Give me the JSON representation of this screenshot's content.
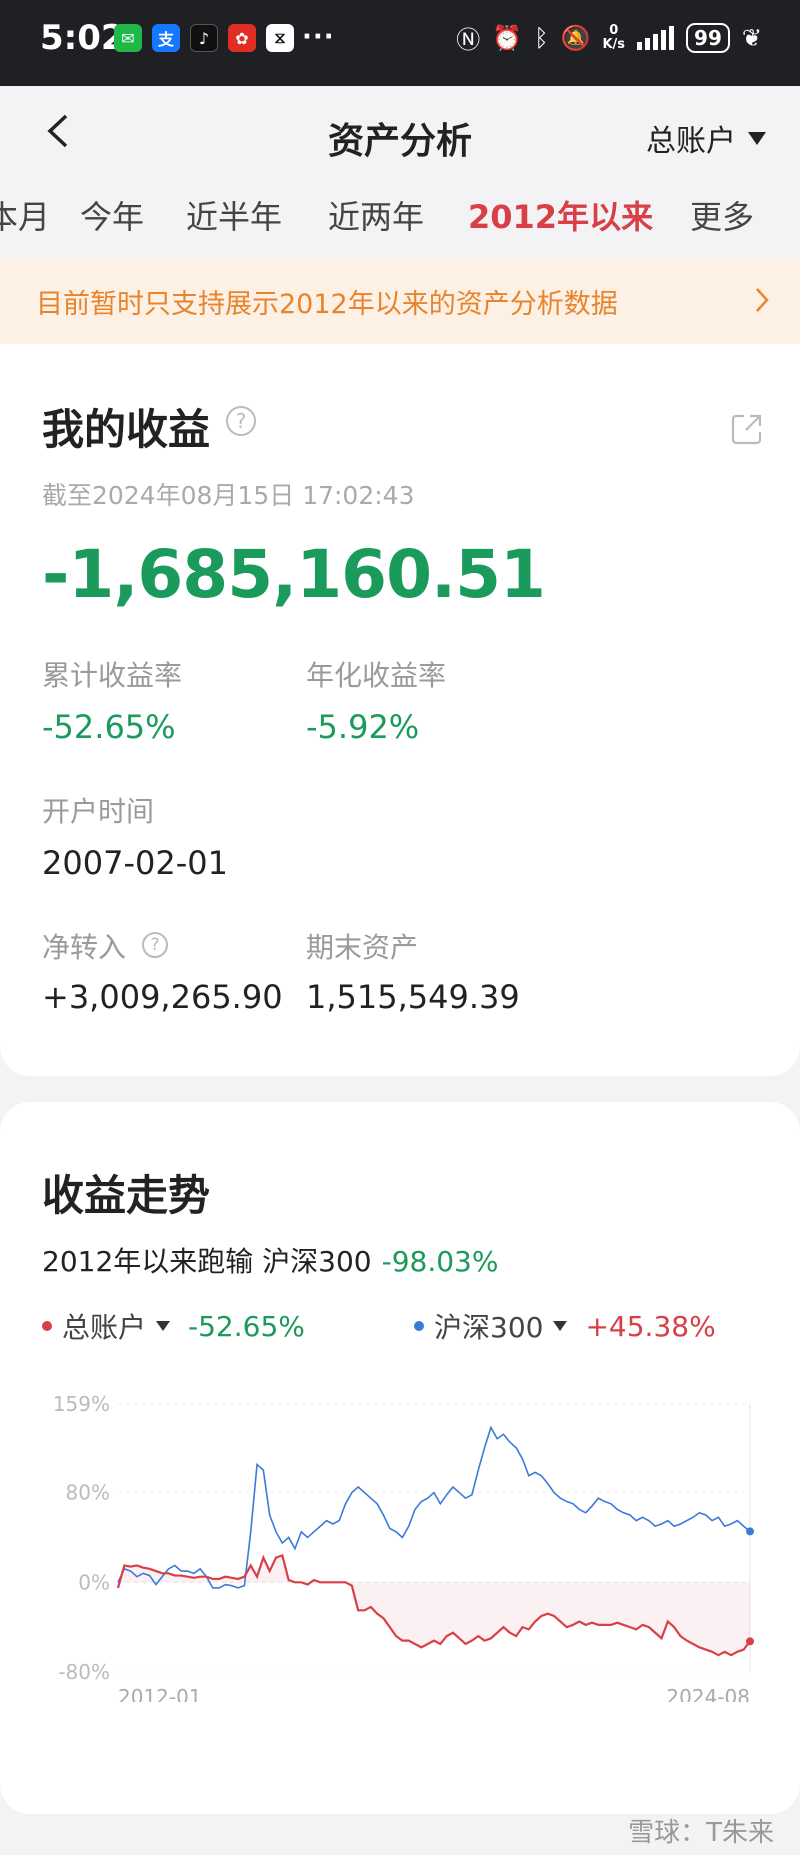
{
  "status": {
    "time": "5:02",
    "dots": "···",
    "net_speed_top": "0",
    "net_speed_bottom": "K/s",
    "battery": "99"
  },
  "header": {
    "title": "资产分析",
    "account": "总账户"
  },
  "tabs": [
    "本月",
    "今年",
    "近半年",
    "近两年",
    "2012年以来",
    "更多"
  ],
  "active_tab": "2012年以来",
  "notice": "目前暂时只支持展示2012年以来的资产分析数据",
  "profit": {
    "title": "我的收益",
    "as_of": "截至2024年08月15日 17:02:43",
    "amount": "-1,685,160.51",
    "cum_rate_label": "累计收益率",
    "cum_rate": "-52.65%",
    "ann_rate_label": "年化收益率",
    "ann_rate": "-5.92%",
    "open_label": "开户时间",
    "open_date": "2007-02-01",
    "net_in_label": "净转入",
    "net_in": "+3,009,265.90",
    "end_asset_label": "期末资产",
    "end_asset": "1,515,549.39"
  },
  "trend": {
    "title": "收益走势",
    "compare_text": "2012年以来跑输 沪深300",
    "compare_value": "-98.03%",
    "legend": [
      {
        "name": "总账户",
        "value": "-52.65%",
        "color": "#d93f47"
      },
      {
        "name": "沪深300",
        "value": "+45.38%",
        "color": "#3b7bd8"
      }
    ]
  },
  "chart_data": {
    "type": "line",
    "yticks": [
      "159%",
      "80%",
      "0%",
      "-80%"
    ],
    "ylim": [
      -80,
      159
    ],
    "x_start_label": "2012-01",
    "x_end_label": "2024-08",
    "series": [
      {
        "name": "总账户",
        "color": "#d93f47",
        "values": [
          -5,
          15,
          14,
          15,
          13,
          12,
          10,
          8,
          8,
          6,
          6,
          5,
          4,
          5,
          5,
          3,
          3,
          5,
          4,
          3,
          5,
          15,
          5,
          22,
          10,
          22,
          24,
          2,
          0,
          0,
          -2,
          2,
          0,
          0,
          0,
          0,
          0,
          -3,
          -25,
          -25,
          -22,
          -28,
          -32,
          -40,
          -48,
          -52,
          -52,
          -55,
          -58,
          -55,
          -52,
          -55,
          -48,
          -45,
          -50,
          -55,
          -52,
          -48,
          -52,
          -50,
          -45,
          -40,
          -45,
          -48,
          -40,
          -42,
          -35,
          -30,
          -28,
          -30,
          -35,
          -40,
          -38,
          -35,
          -38,
          -36,
          -38,
          -38,
          -38,
          -36,
          -38,
          -40,
          -42,
          -38,
          -40,
          -45,
          -50,
          -35,
          -40,
          -48,
          -52,
          -55,
          -58,
          -60,
          -62,
          -65,
          -62,
          -65,
          -62,
          -60,
          -52.65
        ]
      },
      {
        "name": "沪深300",
        "color": "#3b7bd8",
        "values": [
          0,
          12,
          10,
          5,
          8,
          6,
          -2,
          5,
          12,
          15,
          10,
          10,
          8,
          12,
          5,
          -5,
          -5,
          -2,
          -3,
          -5,
          -3,
          45,
          105,
          100,
          60,
          45,
          35,
          40,
          30,
          45,
          40,
          45,
          50,
          55,
          52,
          55,
          70,
          80,
          85,
          80,
          75,
          70,
          60,
          48,
          45,
          40,
          50,
          65,
          72,
          75,
          80,
          70,
          78,
          85,
          80,
          75,
          78,
          100,
          120,
          138,
          128,
          132,
          125,
          120,
          110,
          95,
          98,
          95,
          88,
          80,
          75,
          72,
          70,
          65,
          62,
          68,
          75,
          72,
          70,
          65,
          62,
          60,
          55,
          58,
          55,
          50,
          52,
          55,
          50,
          52,
          55,
          58,
          62,
          60,
          55,
          58,
          50,
          52,
          55,
          50,
          45.38
        ]
      }
    ]
  },
  "watermark": "雪球：T朱来"
}
